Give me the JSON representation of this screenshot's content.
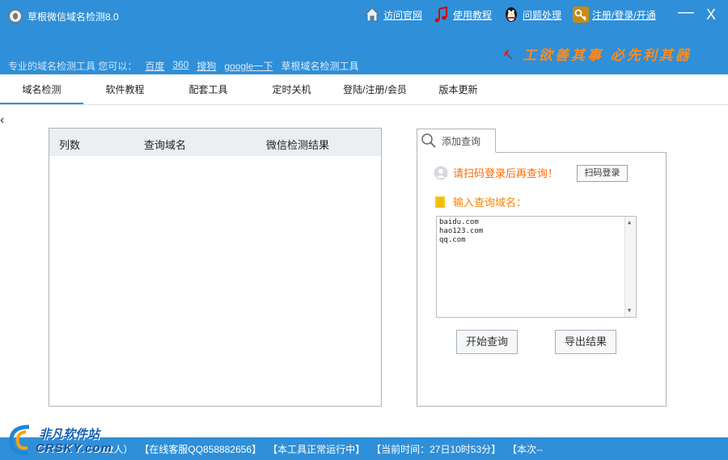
{
  "app": {
    "title": "草根微信域名检测8.0"
  },
  "toplinks": [
    {
      "label": "访问官网",
      "icon": "home-icon"
    },
    {
      "label": "使用教程",
      "icon": "music-note-icon"
    },
    {
      "label": "问题处理",
      "icon": "qq-penguin-icon"
    },
    {
      "label": "注册/登录/开通",
      "icon": "key-icon"
    }
  ],
  "window": {
    "minimize": "—",
    "close": "X"
  },
  "slogan": "工欲善其事 必先利其器",
  "subbar": {
    "intro": "专业的域名检测工具 您可以：",
    "links": [
      "百度",
      "360",
      "搜狗",
      "google一下"
    ],
    "product": "草根域名检测工具"
  },
  "tabs": [
    "域名检测",
    "软件教程",
    "配套工具",
    "定时关机",
    "登陆/注册/会员",
    "版本更新"
  ],
  "results": {
    "columns": [
      "列数",
      "查询域名",
      "微信检测结果"
    ]
  },
  "query": {
    "tab_label": "添加查询",
    "login_msg": "请扫码登录后再查询！",
    "scan_login": "扫码登录",
    "enter_label": "输入查询域名：",
    "domains": [
      "baidu.com",
      "hao123.com",
      "qq.com"
    ],
    "start_button": "开始查询",
    "export_button": "导出结果"
  },
  "status": {
    "online": "：72人）",
    "service": "【在线客服QQ858882656】",
    "running": "【本工具正常运行中】",
    "time": "【当前时间：27日10时53分】",
    "this_time": "【本次--"
  },
  "watermark": {
    "cn": "非凡软件站",
    "en": "CRSKY.com"
  },
  "colors": {
    "primary": "#2f8fd8",
    "accent": "#ff8000",
    "slogan": "#ff8a1c"
  }
}
